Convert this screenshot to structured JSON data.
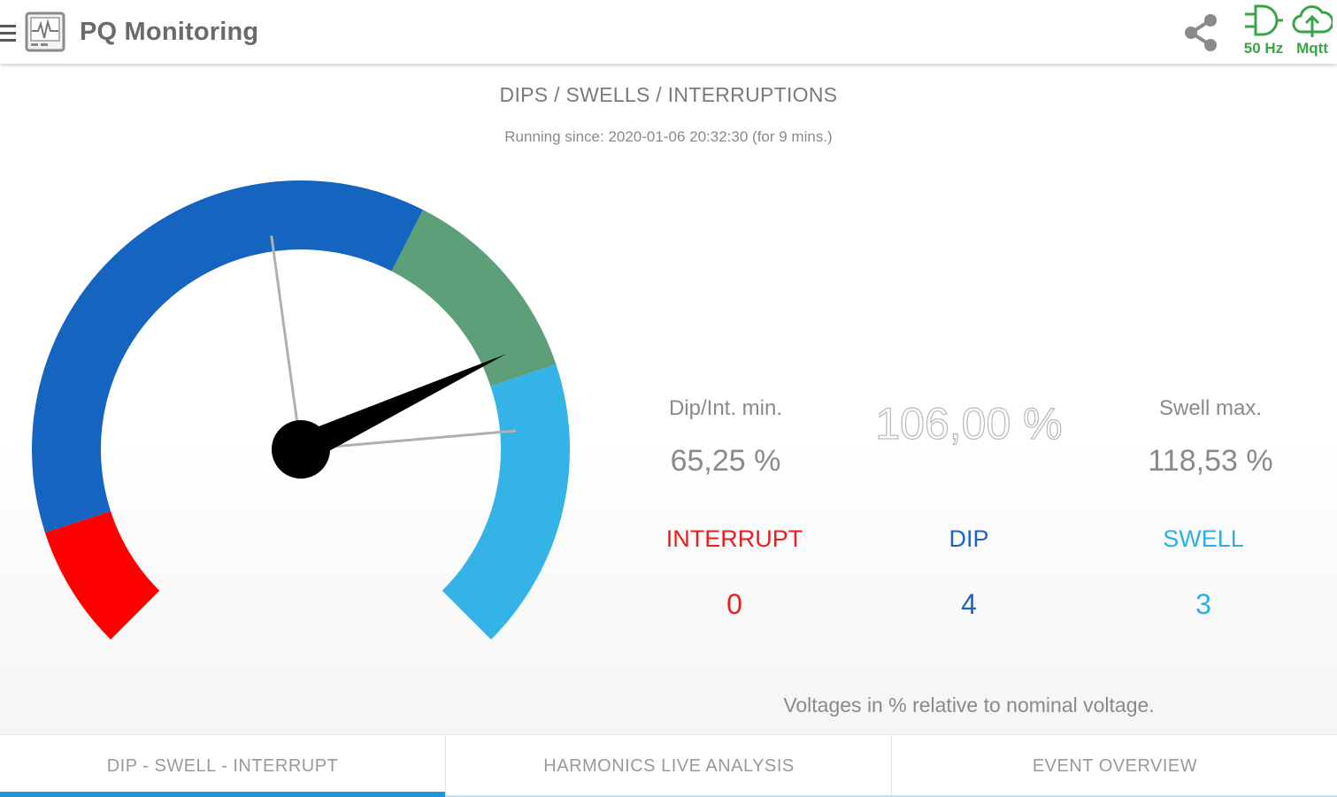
{
  "app": {
    "title": "PQ Monitoring",
    "frequency_label": "50 Hz",
    "mqtt_label": "Mqtt",
    "status_color": "#3aa547"
  },
  "icons": {
    "menu": "menu-icon",
    "logo": "waveform-monitor-icon",
    "share": "share-icon",
    "frequency": "logic-gate-icon",
    "mqtt": "cloud-upload-icon"
  },
  "section": {
    "title": "DIPS / SWELLS / INTERRUPTIONS",
    "running_since": "Running since: 2020-01-06 20:32:30 (for 9 mins.)"
  },
  "gauge": {
    "start_angle_deg": 225,
    "sweep_deg": 270,
    "bands": [
      {
        "name": "interrupt",
        "color": "#ff0000",
        "from": 0.0,
        "to": 0.1
      },
      {
        "name": "dip",
        "color": "#1565c0",
        "from": 0.1,
        "to": 0.6
      },
      {
        "name": "normal",
        "color": "#5d9f78",
        "from": 0.6,
        "to": 0.765
      },
      {
        "name": "swell",
        "color": "#33b3e6",
        "from": 0.765,
        "to": 1.0
      }
    ],
    "needle_fraction": 0.741,
    "min_marker_fraction": 0.471,
    "max_marker_fraction": 0.815
  },
  "stats": {
    "dip_min_label": "Dip/Int. min.",
    "dip_min_value": "65,25 %",
    "current_value": "106,00 %",
    "swell_max_label": "Swell max.",
    "swell_max_value": "118,53 %"
  },
  "counters": {
    "interrupt": {
      "label": "INTERRUPT",
      "value": "0",
      "color": "#f01b1b"
    },
    "dip": {
      "label": "DIP",
      "value": "4",
      "color": "#1e63c4"
    },
    "swell": {
      "label": "SWELL",
      "value": "3",
      "color": "#2bb0e6"
    }
  },
  "footnote": "Voltages in % relative to nominal voltage.",
  "tabs": [
    {
      "label": "DIP - SWELL - INTERRUPT",
      "active": true
    },
    {
      "label": "HARMONICS LIVE ANALYSIS",
      "active": false
    },
    {
      "label": "EVENT OVERVIEW",
      "active": false
    }
  ]
}
